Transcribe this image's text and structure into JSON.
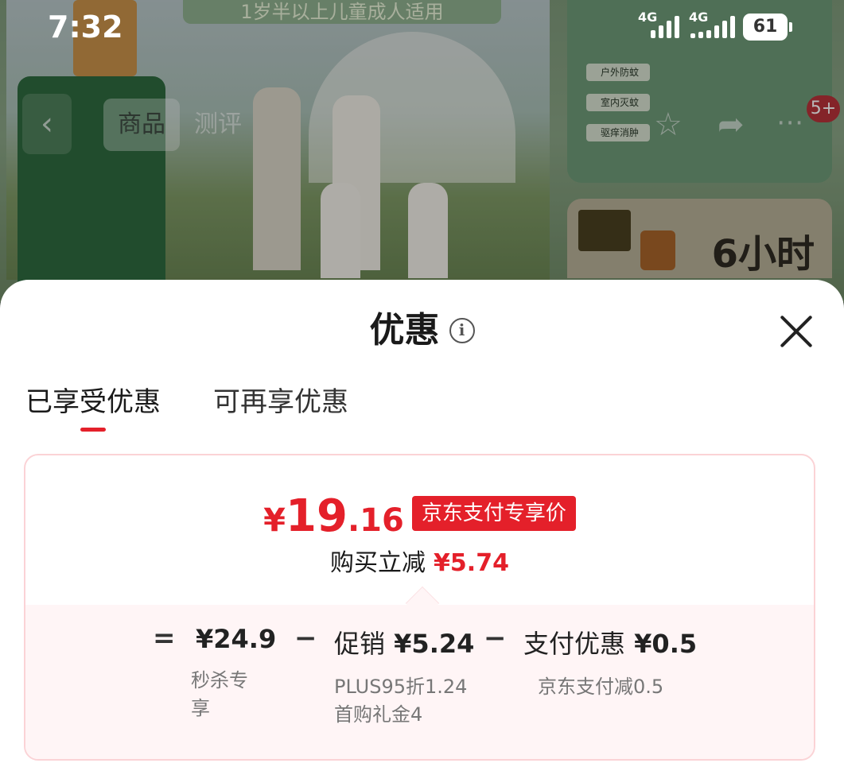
{
  "status_bar": {
    "time": "7:32",
    "network_1": "4G",
    "network_2": "4G",
    "battery": "61"
  },
  "background_page": {
    "banner_text": "1岁半以上儿童成人适用",
    "nav": {
      "tab_product": "商品",
      "tab_review": "测评"
    },
    "side_labels": [
      "户外防蚊",
      "室内灭蚊",
      "驱痒消肿"
    ],
    "promo_text": "6小时",
    "cart_badge": "5+"
  },
  "sheet": {
    "title": "优惠",
    "info_icon": "i",
    "tabs": [
      {
        "label": "已享受优惠",
        "active": true
      },
      {
        "label": "可再享优惠",
        "active": false
      }
    ],
    "card": {
      "price_yen": "¥",
      "price_int": "19",
      "price_dec": ".16",
      "price_tag": "京东支付专享价",
      "saving_label": "购买立减",
      "saving_amount": "¥5.74",
      "breakdown": {
        "equals": "=",
        "minus": "−",
        "original_price": "¥24.9",
        "original_note": "秒杀专享",
        "promo_label": "促销",
        "promo_amount": "¥5.24",
        "promo_notes": [
          "PLUS95折1.24",
          "首购礼金4"
        ],
        "payment_label": "支付优惠",
        "payment_amount": "¥0.5",
        "payment_note": "京东支付减0.5"
      }
    }
  },
  "colors": {
    "accent_red": "#e4202a",
    "card_border": "#fbd3d6",
    "breakdown_bg": "#fff5f6"
  }
}
